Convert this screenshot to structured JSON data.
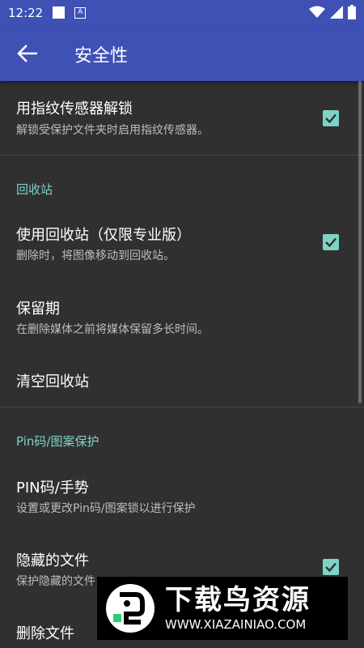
{
  "status_bar": {
    "time": "12:22",
    "notification_letter": "A"
  },
  "app_bar": {
    "title": "安全性"
  },
  "items": {
    "fingerprint": {
      "title": "用指纹传感器解锁",
      "summary": "解锁受保护文件夹时启用指纹传感器。",
      "checked": true
    },
    "recycle_header": "回收站",
    "use_recycle": {
      "title": "使用回收站（仅限专业版）",
      "summary": "删除时，将图像移动到回收站。",
      "checked": true
    },
    "retention": {
      "title": "保留期",
      "summary": "在删除媒体之前将媒体保留多长时间。"
    },
    "empty_recycle": {
      "title": "清空回收站"
    },
    "pin_header": "Pin码/图案保护",
    "pin": {
      "title": "PIN码/手势",
      "summary": "设置或更改Pin码/图案锁以进行保护"
    },
    "hidden_files": {
      "title": "隐藏的文件",
      "summary": "保护隐藏的文件",
      "checked": true
    },
    "delete_files": {
      "title": "删除文件"
    }
  },
  "watermark": {
    "title": "下载鸟资源",
    "url": "WWW.XIAZAINIAO.COM"
  },
  "colors": {
    "primary": "#3F51B5",
    "accent": "#7ED3C7",
    "background": "#303030"
  }
}
